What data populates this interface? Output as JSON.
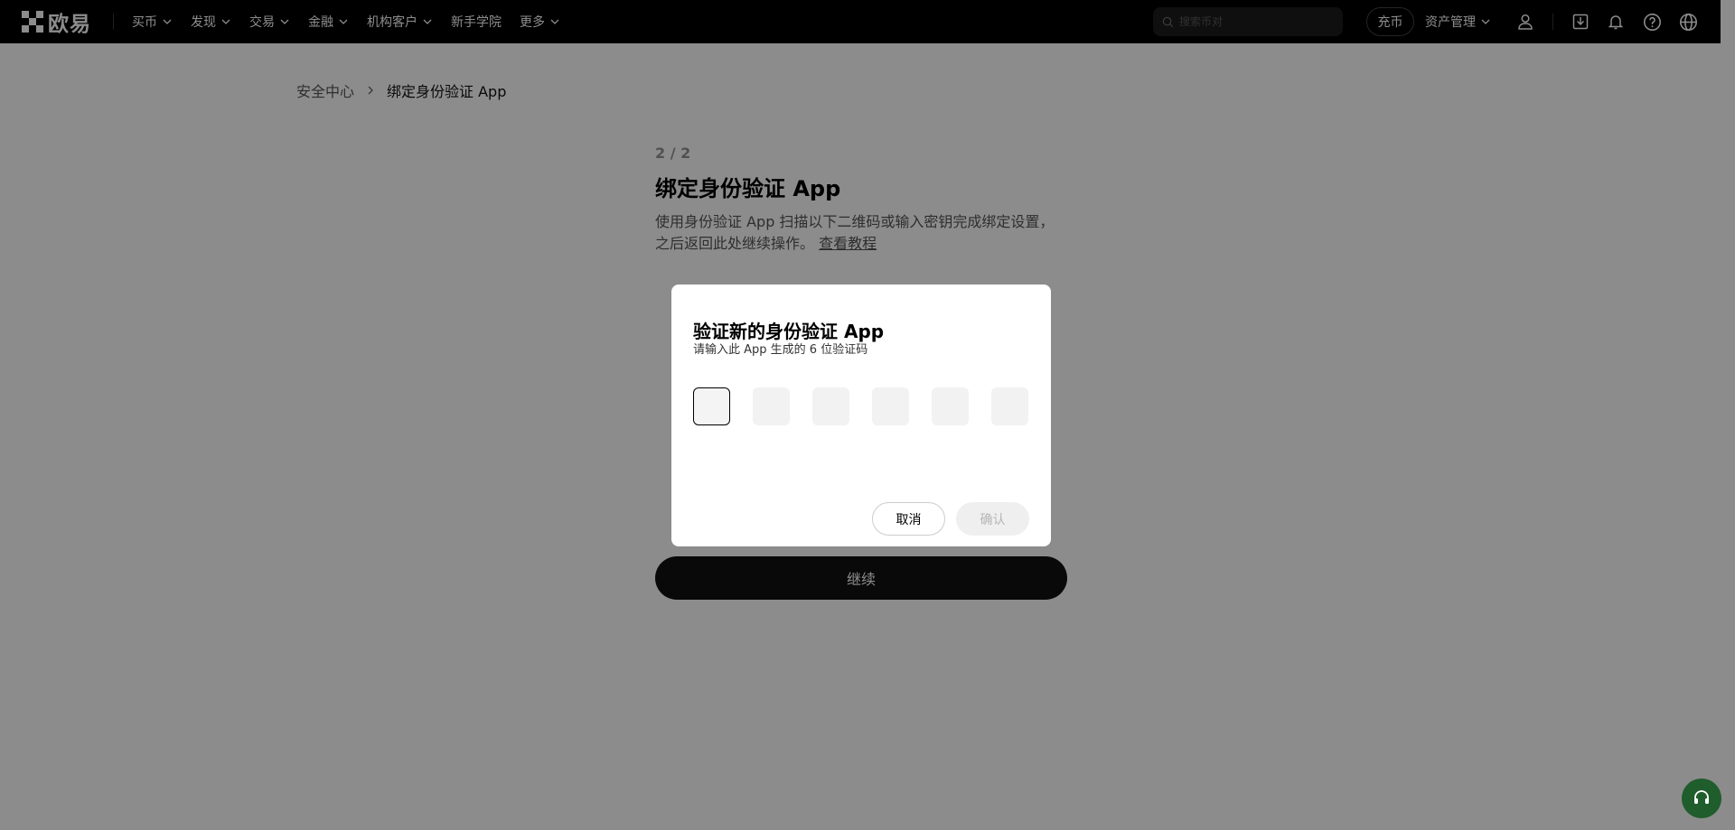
{
  "header": {
    "brand_name": "欧易",
    "nav_items": [
      {
        "label": "买币",
        "has_dropdown": true
      },
      {
        "label": "发现",
        "has_dropdown": true
      },
      {
        "label": "交易",
        "has_dropdown": true
      },
      {
        "label": "金融",
        "has_dropdown": true
      },
      {
        "label": "机构客户",
        "has_dropdown": true
      },
      {
        "label": "新手学院",
        "has_dropdown": false
      },
      {
        "label": "更多",
        "has_dropdown": true
      }
    ],
    "search_placeholder": "搜索币对",
    "deposit_label": "充币",
    "assets_label": "资产管理",
    "icons": [
      "user-icon",
      "download-icon",
      "bell-icon",
      "help-icon",
      "globe-icon"
    ]
  },
  "breadcrumb": {
    "parent": "安全中心",
    "current": "绑定身份验证 App"
  },
  "main": {
    "step": "2 / 2",
    "title": "绑定身份验证 App",
    "description": "使用身份验证 App 扫描以下二维码或输入密钥完成绑定设置，之后返回此处继续操作。",
    "tutorial_link": "查看教程",
    "continue_label": "继续"
  },
  "modal": {
    "title": "验证新的身份验证 App",
    "subtitle": "请输入此 App 生成的 6 位验证码",
    "code_digits": [
      "",
      "",
      "",
      "",
      "",
      ""
    ],
    "cancel_label": "取消",
    "confirm_label": "确认"
  },
  "colors": {
    "header_bg": "#000000",
    "primary": "#121212",
    "overlay": "rgba(0,0,0,0.45)",
    "support_button": "#1f5d2c"
  }
}
